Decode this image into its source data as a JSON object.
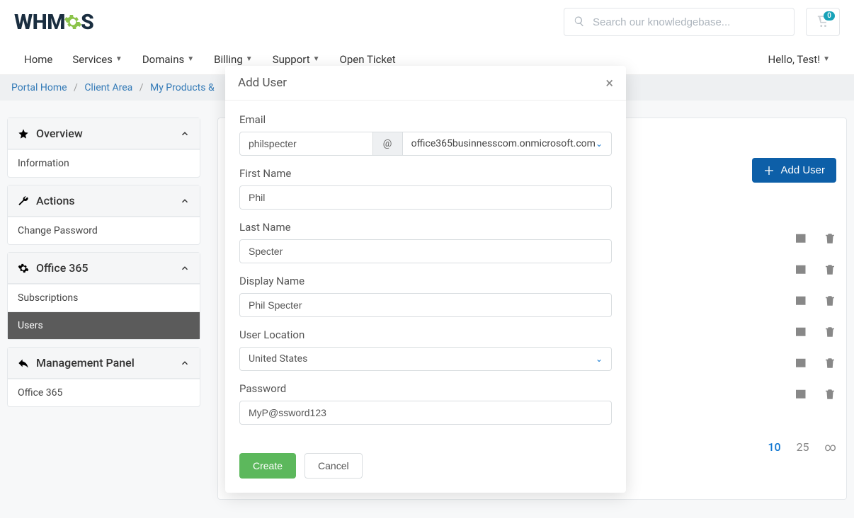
{
  "header": {
    "logo_pre": "WHM",
    "logo_post": "S",
    "search_placeholder": "Search our knowledgebase...",
    "cart_count": "0"
  },
  "nav": {
    "home": "Home",
    "services": "Services",
    "domains": "Domains",
    "billing": "Billing",
    "support": "Support",
    "open_ticket": "Open Ticket",
    "greeting": "Hello, Test!"
  },
  "breadcrumb": {
    "portal_home": "Portal Home",
    "client_area": "Client Area",
    "products": "My Products &"
  },
  "sidebar": {
    "overview": {
      "title": "Overview",
      "item_info": "Information"
    },
    "actions": {
      "title": "Actions",
      "item_pw": "Change Password"
    },
    "office365": {
      "title": "Office 365",
      "item_subs": "Subscriptions",
      "item_users": "Users"
    },
    "mgmt": {
      "title": "Management Panel",
      "item_o365": "Office 365"
    }
  },
  "main": {
    "add_user_label": "Add User",
    "pager_10": "10",
    "pager_25": "25",
    "pager_inf": "∞"
  },
  "modal": {
    "title": "Add User",
    "email_label": "Email",
    "email_local": "philspecter",
    "email_at": "@",
    "email_domain": "office365businnesscom.onmicrosoft.com",
    "first_name_label": "First Name",
    "first_name_value": "Phil",
    "last_name_label": "Last Name",
    "last_name_value": "Specter",
    "display_name_label": "Display Name",
    "display_name_value": "Phil Specter",
    "location_label": "User Location",
    "location_value": "United States",
    "password_label": "Password",
    "password_value": "MyP@ssword123",
    "create_label": "Create",
    "cancel_label": "Cancel"
  }
}
